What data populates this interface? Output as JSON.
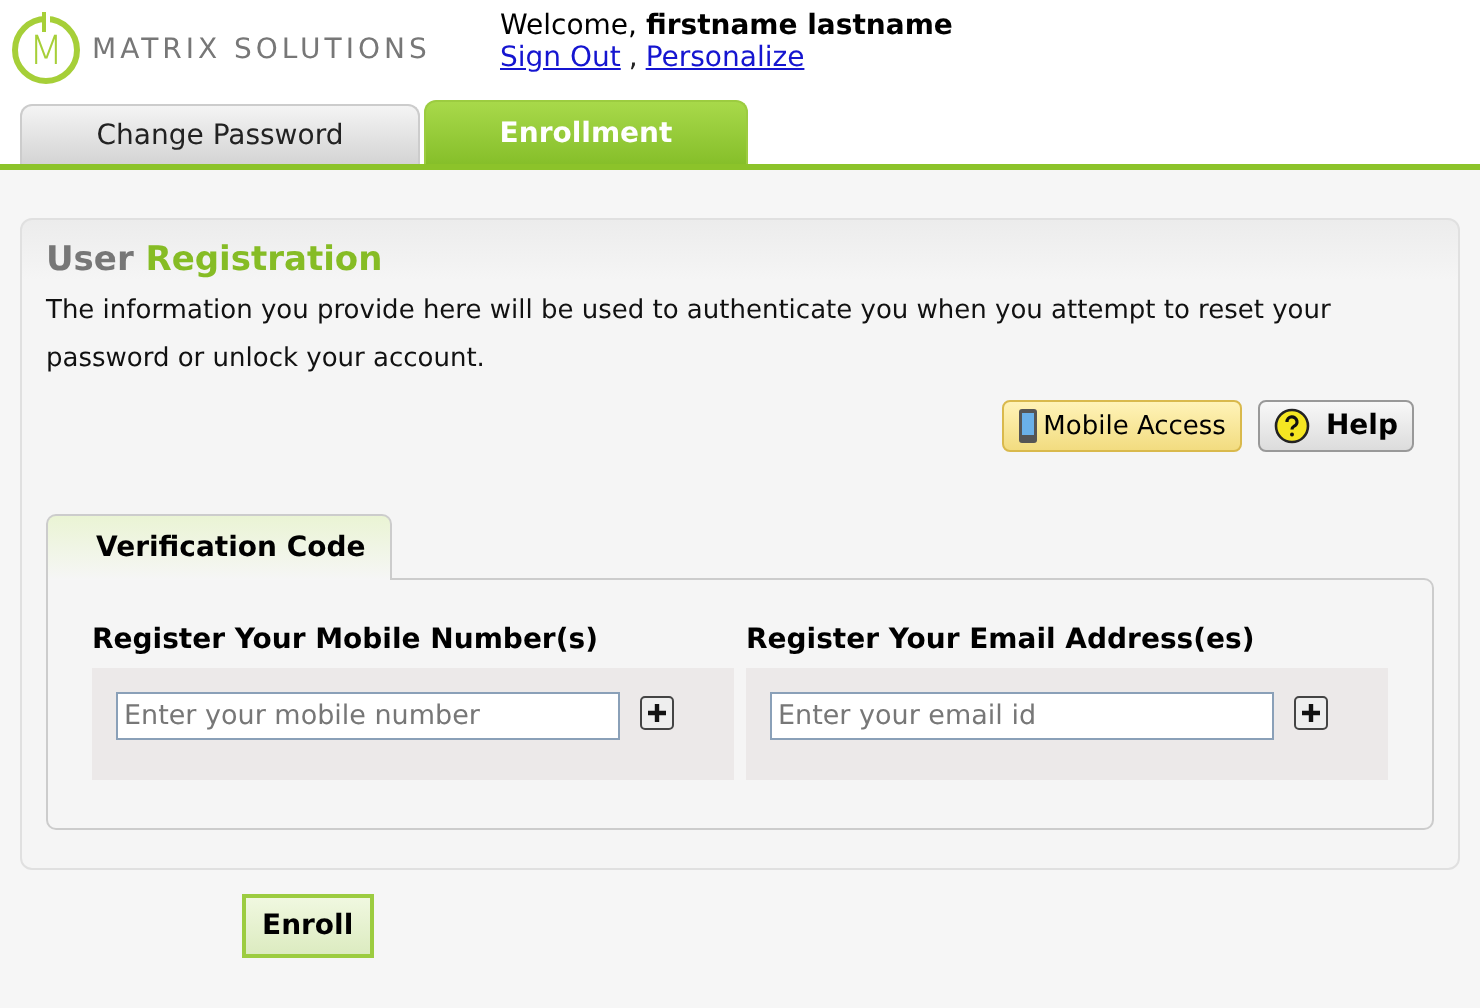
{
  "logo": {
    "letter": "M",
    "name": "MATRIX SOLUTIONS"
  },
  "user": {
    "welcome": "Welcome, **firstname lastname**",
    "links": [
      "Sign Out",
      "Personalize"
    ],
    "separator": ","
  },
  "tabs": [
    {
      "label": "Change Password",
      "selected": false
    },
    {
      "label": "Enrollment",
      "selected": true
    }
  ],
  "panel": {
    "title_words": [
      "User",
      "Registration"
    ],
    "description": "The information you provide here will be used to authenticate you when you attempt to reset your password or unlock your account.",
    "buttons": [
      {
        "kind": "mobile",
        "label": "Mobile Access"
      },
      {
        "kind": "help",
        "label": "Help"
      }
    ],
    "section_tab": "Verification Code",
    "groups": [
      {
        "label": "Register Your Mobile Number(s)",
        "placeholder": "Enter your mobile number"
      },
      {
        "label": "Register Your Email Address(es)",
        "placeholder": "Enter your email id"
      }
    ],
    "submit": "Enroll"
  }
}
